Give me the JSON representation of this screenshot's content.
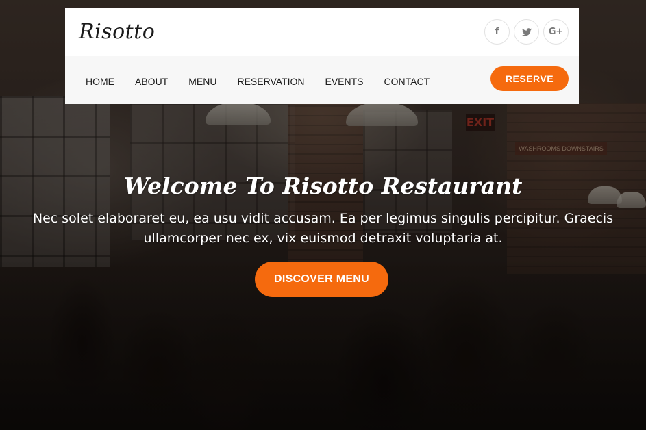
{
  "brand": {
    "logo_text": "Risotto"
  },
  "social": [
    {
      "icon": "facebook-icon",
      "glyph": "f"
    },
    {
      "icon": "twitter-icon",
      "glyph": ""
    },
    {
      "icon": "google-plus-icon",
      "glyph": "G+"
    }
  ],
  "nav": {
    "items": [
      "HOME",
      "ABOUT",
      "MENU",
      "RESERVATION",
      "EVENTS",
      "CONTACT"
    ],
    "reserve_label": "RESERVE"
  },
  "hero": {
    "title": "Welcome To Risotto Restaurant",
    "subtitle": "Nec solet elaboraret eu, ea usu vidit accusam. Ea per legimus singulis percipitur. Graecis ullamcorper nec ex, vix euismod detraxit voluptaria at.",
    "cta_label": "DISCOVER MENU",
    "background_signs": {
      "exit": "EXIT",
      "washrooms": "WASHROOMS DOWNSTAIRS"
    }
  },
  "colors": {
    "accent": "#f56a0e",
    "header_bg": "#ffffff",
    "nav_bg": "#f7f7f7",
    "nav_text": "#1d1d1d",
    "icon_color": "#7a7a7a"
  }
}
